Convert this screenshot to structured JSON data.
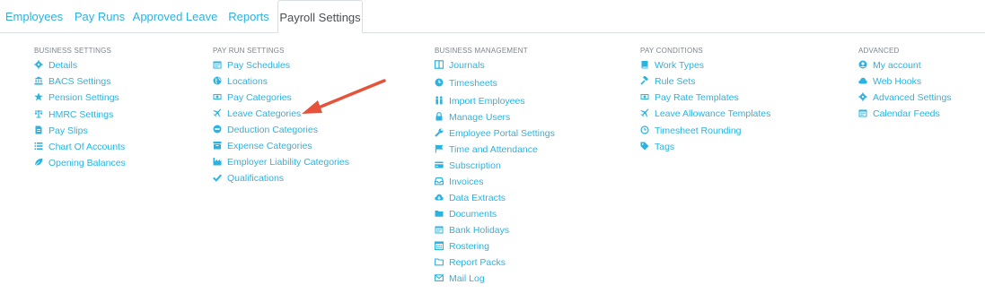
{
  "tabs": [
    {
      "label": "Employees"
    },
    {
      "label": "Pay Runs"
    },
    {
      "label": "Approved Leave"
    },
    {
      "label": "Reports"
    },
    {
      "label": "Payroll Settings",
      "active": true
    }
  ],
  "columns": [
    {
      "heading": "BUSINESS SETTINGS",
      "items": [
        {
          "label": "Details",
          "icon": "gear-icon"
        },
        {
          "label": "BACS Settings",
          "icon": "bank-icon"
        },
        {
          "label": "Pension Settings",
          "icon": "star-icon"
        },
        {
          "label": "HMRC Settings",
          "icon": "scales-icon"
        },
        {
          "label": "Pay Slips",
          "icon": "file-icon"
        },
        {
          "label": "Chart Of Accounts",
          "icon": "list-icon"
        },
        {
          "label": "Opening Balances",
          "icon": "leaf-icon"
        }
      ]
    },
    {
      "heading": "PAY RUN SETTINGS",
      "items": [
        {
          "label": "Pay Schedules",
          "icon": "calendar-icon"
        },
        {
          "label": "Locations",
          "icon": "globe-icon"
        },
        {
          "label": "Pay Categories",
          "icon": "money-icon"
        },
        {
          "label": "Leave Categories",
          "icon": "plane-icon"
        },
        {
          "label": "Deduction Categories",
          "icon": "minus-circle-icon"
        },
        {
          "label": "Expense Categories",
          "icon": "archive-icon"
        },
        {
          "label": "Employer Liability Categories",
          "icon": "industry-icon"
        },
        {
          "label": "Qualifications",
          "icon": "check-icon"
        }
      ]
    },
    {
      "heading": "BUSINESS MANAGEMENT",
      "items": [
        {
          "label": "Journals",
          "icon": "columns-icon"
        },
        {
          "label": "Timesheets",
          "icon": "clock-icon"
        },
        {
          "label": "Import Employees",
          "icon": "users-icon"
        },
        {
          "label": "Manage Users",
          "icon": "lock-icon"
        },
        {
          "label": "Employee Portal Settings",
          "icon": "wrench-icon"
        },
        {
          "label": "Time and Attendance",
          "icon": "flag-icon"
        },
        {
          "label": "Subscription",
          "icon": "credit-card-icon"
        },
        {
          "label": "Invoices",
          "icon": "inbox-icon"
        },
        {
          "label": "Data Extracts",
          "icon": "cloud-download-icon"
        },
        {
          "label": "Documents",
          "icon": "folder-icon"
        },
        {
          "label": "Bank Holidays",
          "icon": "calendar-icon"
        },
        {
          "label": "Rostering",
          "icon": "calendar-grid-icon"
        },
        {
          "label": "Report Packs",
          "icon": "folder-open-icon"
        },
        {
          "label": "Mail Log",
          "icon": "envelope-icon"
        }
      ]
    },
    {
      "heading": "PAY CONDITIONS",
      "items": [
        {
          "label": "Work Types",
          "icon": "book-icon"
        },
        {
          "label": "Rule Sets",
          "icon": "gavel-icon"
        },
        {
          "label": "Pay Rate Templates",
          "icon": "money-icon"
        },
        {
          "label": "Leave Allowance Templates",
          "icon": "plane-icon"
        },
        {
          "label": "Timesheet Rounding",
          "icon": "clock-outline-icon"
        },
        {
          "label": "Tags",
          "icon": "tag-icon"
        }
      ]
    },
    {
      "heading": "ADVANCED",
      "items": [
        {
          "label": "My account",
          "icon": "user-circle-icon"
        },
        {
          "label": "Web Hooks",
          "icon": "cloud-icon"
        },
        {
          "label": "Advanced Settings",
          "icon": "gear-icon"
        },
        {
          "label": "Calendar Feeds",
          "icon": "calendar-icon"
        }
      ]
    }
  ],
  "colors": {
    "link": "#2ab3e0",
    "heading": "#7d8590",
    "active_tab_text": "#4a4f55",
    "border": "#d9dee3",
    "annotation_arrow": "#e5533d"
  }
}
